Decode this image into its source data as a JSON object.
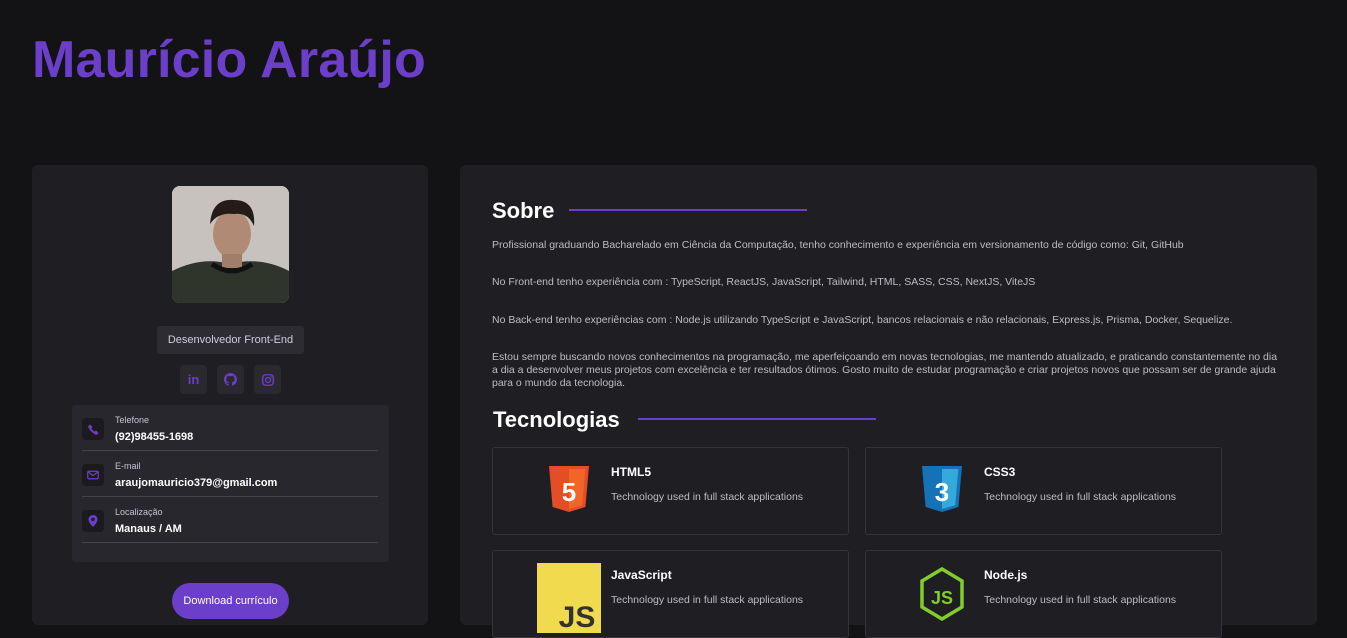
{
  "header": {
    "name": "Maurício Araújo"
  },
  "profile": {
    "role": "Desenvolvedor Front-End",
    "social": [
      {
        "label": "in",
        "icon": "linkedin-icon"
      },
      {
        "icon": "github-icon"
      },
      {
        "icon": "instagram-icon"
      }
    ],
    "contacts": [
      {
        "label": "Telefone",
        "value": "(92)98455-1698",
        "icon": "phone-icon"
      },
      {
        "label": "E-mail",
        "value": "araujomauricio379@gmail.com",
        "icon": "mail-icon"
      },
      {
        "label": "Localização",
        "value": "Manaus / AM",
        "icon": "location-pin-icon"
      }
    ],
    "download_label": "Download currículo"
  },
  "about": {
    "title": "Sobre",
    "paragraphs": [
      "Profissional graduando Bacharelado em Ciência da Computação, tenho conhecimento e experiência em versionamento de código como: Git, GitHub",
      "No Front-end tenho experiência com : TypeScript, ReactJS, JavaScript, Tailwind, HTML, SASS, CSS, NextJS, ViteJS",
      "No Back-end tenho experiências com : Node.js utilizando TypeScript e JavaScript, bancos relacionais e não relacionais, Express.js, Prisma, Docker, Sequelize.",
      "Estou sempre buscando novos conhecimentos na programação, me aperfeiçoando em novas tecnologias, me mantendo atualizado, e praticando constantemente no dia a dia a desenvolver meus projetos com excelência e ter resultados ótimos. Gosto muito de estudar programação e criar projetos novos que possam ser de grande ajuda para o mundo da tecnologia."
    ]
  },
  "technologies": {
    "title": "Tecnologias",
    "items": [
      {
        "name": "HTML5",
        "description": "Technology used in full stack applications",
        "icon": "html5-icon",
        "logo_text": "5"
      },
      {
        "name": "CSS3",
        "description": "Technology used in full stack applications",
        "icon": "css3-icon",
        "logo_text": "3"
      },
      {
        "name": "JavaScript",
        "description": "Technology used in full stack applications",
        "icon": "javascript-icon",
        "logo_text": "JS"
      },
      {
        "name": "Node.js",
        "description": "Technology used in full stack applications",
        "icon": "nodejs-icon",
        "logo_text": "JS"
      }
    ]
  },
  "colors": {
    "accent": "#6b3fc9",
    "background": "#131316",
    "card": "#1f1e23"
  }
}
